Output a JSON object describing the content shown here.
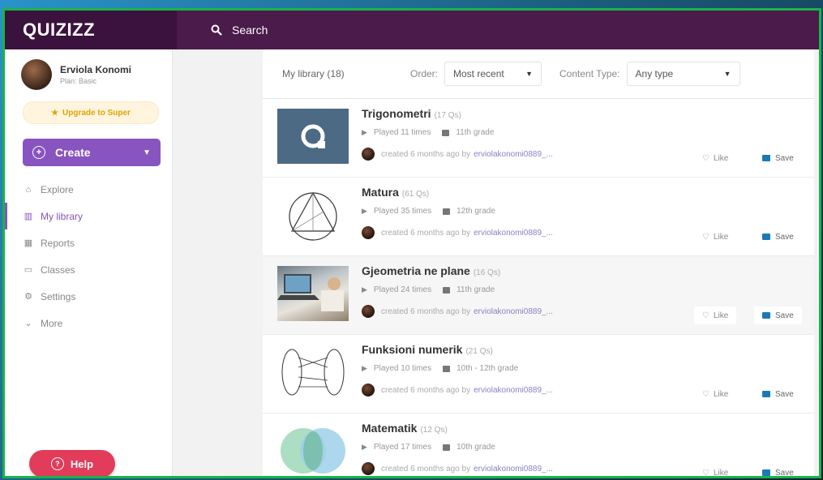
{
  "app": {
    "logo": "QUIZIZZ"
  },
  "search": {
    "label": "Search"
  },
  "profile": {
    "name": "Erviola Konomi",
    "plan": "Plan: Basic"
  },
  "sidebar": {
    "upgrade_label": "Upgrade to Super",
    "create_label": "Create",
    "items": [
      {
        "label": "Explore",
        "icon": "explore-icon",
        "active": false
      },
      {
        "label": "My library",
        "icon": "library-icon",
        "active": true
      },
      {
        "label": "Reports",
        "icon": "reports-icon",
        "active": false
      },
      {
        "label": "Classes",
        "icon": "classes-icon",
        "active": false
      },
      {
        "label": "Settings",
        "icon": "settings-icon",
        "active": false
      },
      {
        "label": "More",
        "icon": "chevron-down-icon",
        "active": false
      }
    ],
    "help_label": "Help"
  },
  "filters": {
    "library_label": "My library (18)",
    "order_label": "Order:",
    "order_value": "Most recent",
    "content_type_label": "Content Type:",
    "content_type_value": "Any type"
  },
  "quizzes": [
    {
      "title": "Trigonometri",
      "qs": "(17 Qs)",
      "played": "Played 11 times",
      "grade": "11th grade",
      "created": "created 6 months ago by",
      "author": "erviolakonomi0889_...",
      "like": "Like",
      "save": "Save"
    },
    {
      "title": "Matura",
      "qs": "(61 Qs)",
      "played": "Played 35 times",
      "grade": "12th grade",
      "created": "created 6 months ago by",
      "author": "erviolakonomi0889_...",
      "like": "Like",
      "save": "Save"
    },
    {
      "title": "Gjeometria ne plane",
      "qs": "(16 Qs)",
      "played": "Played 24 times",
      "grade": "11th grade",
      "created": "created 6 months ago by",
      "author": "erviolakonomi0889_...",
      "like": "Like",
      "save": "Save"
    },
    {
      "title": "Funksioni numerik",
      "qs": "(21 Qs)",
      "played": "Played 10 times",
      "grade": "10th - 12th grade",
      "created": "created 6 months ago by",
      "author": "erviolakonomi0889_...",
      "like": "Like",
      "save": "Save"
    },
    {
      "title": "Matematik",
      "qs": "(12 Qs)",
      "played": "Played 17 times",
      "grade": "10th grade",
      "created": "created 6 months ago by",
      "author": "erviolakonomi0889_...",
      "like": "Like",
      "save": "Save"
    }
  ],
  "colors": {
    "brand": "#8854c0",
    "topbar": "#4a1b4b",
    "help": "#e23c5a",
    "frame": "#1bb34a"
  }
}
